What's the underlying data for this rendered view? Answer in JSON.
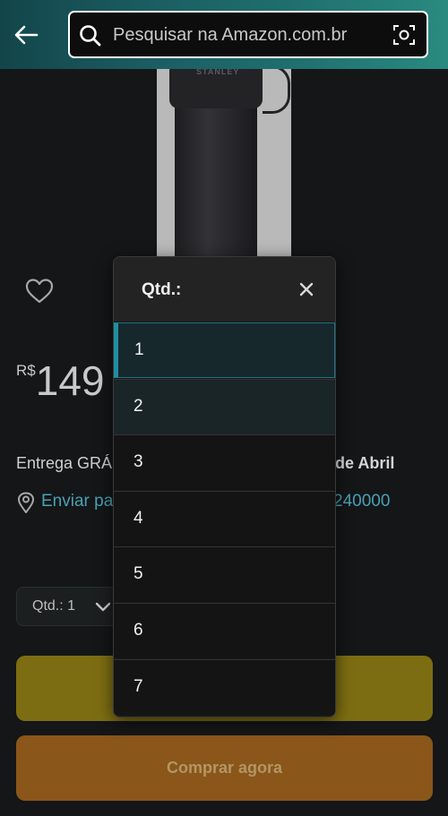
{
  "header": {
    "search_placeholder": "Pesquisar na Amazon.com.br"
  },
  "product": {
    "image_brand": "STANLEY",
    "price_currency": "R$",
    "price_value": "149",
    "delivery_text": "Entrega GRÁ",
    "delivery_date_fragment": "de Abril",
    "ship_to_text": "Enviar pa",
    "zip_fragment": "240000"
  },
  "quantity": {
    "label": "Qtd.:",
    "value": "1"
  },
  "buttons": {
    "buy_now": "Comprar agora"
  },
  "modal": {
    "title": "Qtd.:",
    "options": [
      "1",
      "2",
      "3",
      "4",
      "5",
      "6",
      "7"
    ],
    "selected": "1"
  },
  "colors": {
    "accent": "#1f8fa0",
    "link": "#4aa0b5",
    "add_to_cart": "#7d6d12",
    "buy_now": "#8a5619"
  },
  "icons": [
    "back-arrow-icon",
    "search-icon",
    "camera-icon",
    "heart-icon",
    "location-pin-icon",
    "chevron-down-icon",
    "close-icon"
  ]
}
